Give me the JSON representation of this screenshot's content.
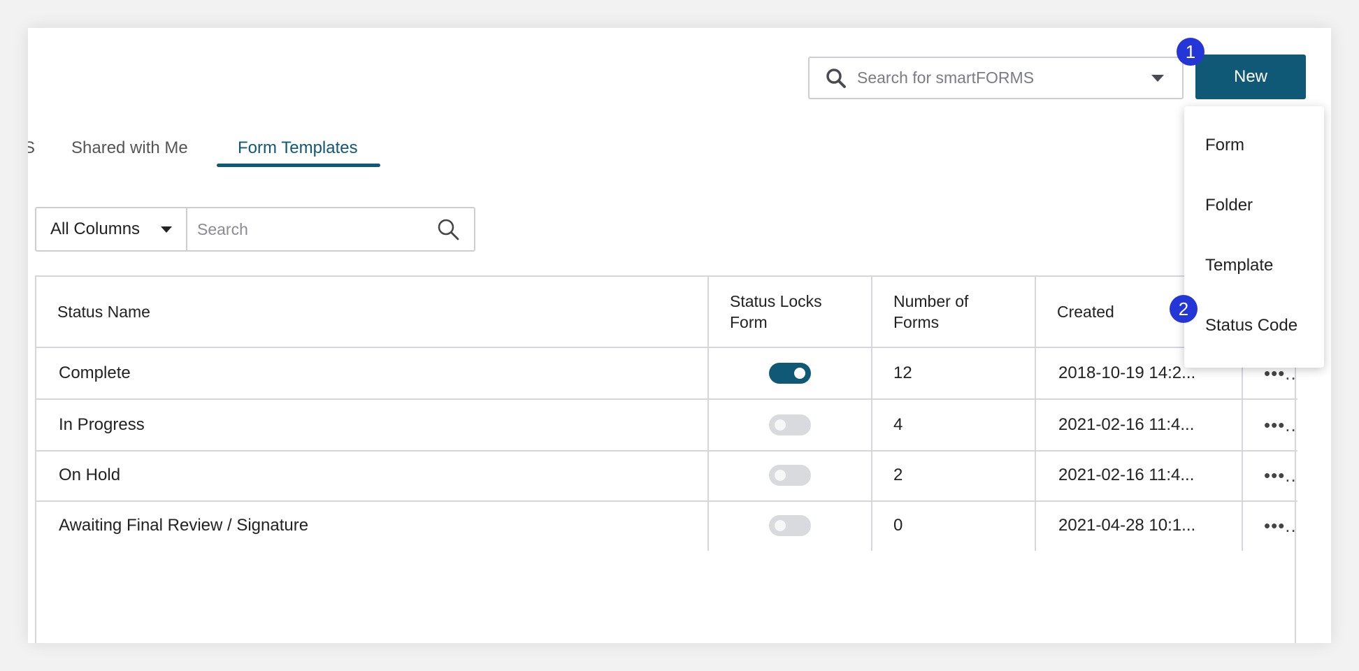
{
  "header": {
    "search": {
      "placeholder": "Search for smartFORMS",
      "icon": "search-icon"
    },
    "new_button_label": "New",
    "step_badges": [
      "1",
      "2"
    ]
  },
  "new_menu": {
    "items": [
      {
        "label": "Form"
      },
      {
        "label": "Folder"
      },
      {
        "label": "Template"
      },
      {
        "label": "Status Code"
      }
    ]
  },
  "tabs": [
    {
      "label": "S",
      "active": false
    },
    {
      "label": "Shared with Me",
      "active": false
    },
    {
      "label": "Form Templates",
      "active": true
    }
  ],
  "filter": {
    "column_select_value": "All Columns",
    "search_placeholder": "Search"
  },
  "table": {
    "columns": [
      "Status Name",
      "Status Locks Form",
      "Number of Forms",
      "Created",
      ""
    ],
    "column_lines": {
      "lock": [
        "Status Locks",
        "Form"
      ],
      "number": [
        "Number of",
        "Forms"
      ]
    },
    "rows": [
      {
        "status_name": "Complete",
        "status_locks_form": true,
        "number_of_forms": "12",
        "created": "2018-10-19 14:2...",
        "actions": "•••.."
      },
      {
        "status_name": "In Progress",
        "status_locks_form": false,
        "number_of_forms": "4",
        "created": "2021-02-16 11:4...",
        "actions": "•••.."
      },
      {
        "status_name": "On Hold",
        "status_locks_form": false,
        "number_of_forms": "2",
        "created": "2021-02-16 11:4...",
        "actions": "•••.."
      },
      {
        "status_name": "Awaiting Final Review / Signature",
        "status_locks_form": false,
        "number_of_forms": "0",
        "created": "2021-04-28 10:1...",
        "actions": "•••.."
      }
    ]
  },
  "colors": {
    "accent": "#0f5876",
    "badge": "#2536d8",
    "border": "#d6d6dc"
  }
}
